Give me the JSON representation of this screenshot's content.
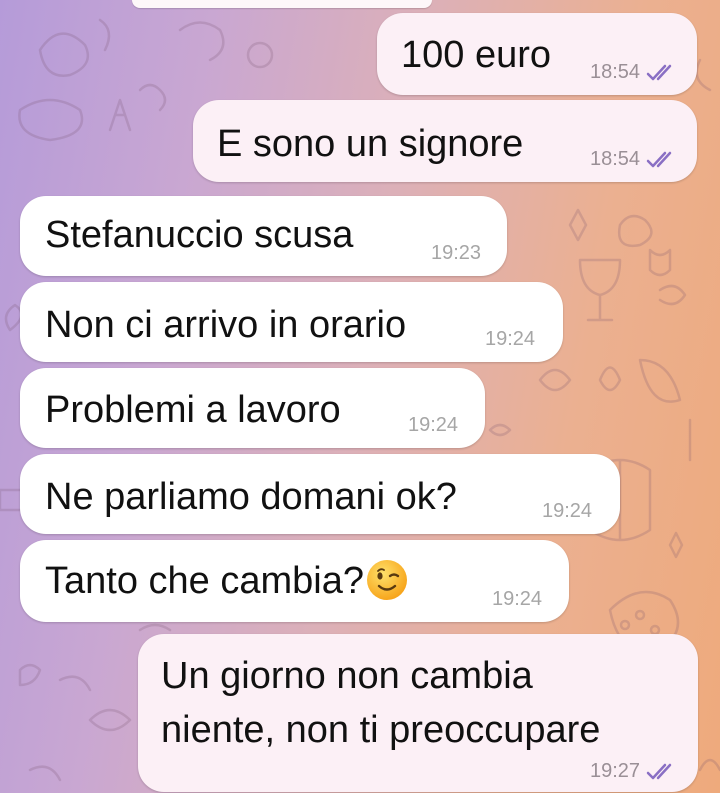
{
  "chat": {
    "messages": [
      {
        "direction": "out",
        "text": "100 euro",
        "time": "18:54",
        "status": "read-double-check"
      },
      {
        "direction": "out",
        "text": "E sono un signore",
        "time": "18:54",
        "status": "read-double-check"
      },
      {
        "direction": "in",
        "text": "Stefanuccio scusa",
        "time": "19:23"
      },
      {
        "direction": "in",
        "text": "Non ci arrivo in orario",
        "time": "19:24"
      },
      {
        "direction": "in",
        "text": "Problemi a lavoro",
        "time": "19:24"
      },
      {
        "direction": "in",
        "text": "Ne parliamo domani ok?",
        "time": "19:24"
      },
      {
        "direction": "in",
        "text": "Tanto che cambia?",
        "time": "19:24",
        "emoji": "winking-face-emoji"
      },
      {
        "direction": "out",
        "text_lines": [
          "Un giorno non cambia",
          "niente, non ti preoccupare"
        ],
        "time": "19:27",
        "status": "read-double-check"
      }
    ]
  },
  "colors": {
    "outgoing_bubble": "#fcf0f6",
    "incoming_bubble": "#ffffff",
    "check_color": "#8a6fc4",
    "background_gradient": [
      "#b59bd9",
      "#eeaa7c"
    ]
  }
}
